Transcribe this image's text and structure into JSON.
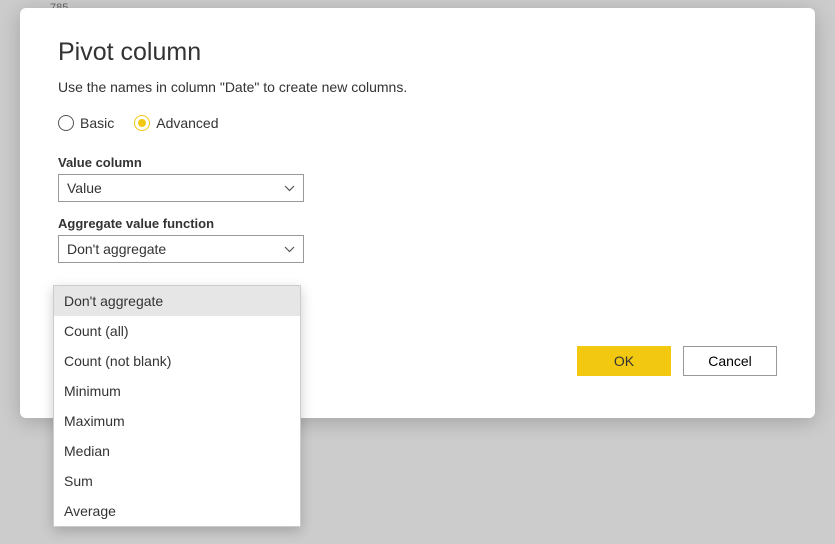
{
  "bg_hint": "785",
  "dialog": {
    "title": "Pivot column",
    "subtitle": "Use the names in column \"Date\" to create new columns.",
    "mode": {
      "basic_label": "Basic",
      "advanced_label": "Advanced"
    },
    "value_column": {
      "label": "Value column",
      "selected": "Value"
    },
    "aggregate": {
      "label": "Aggregate value function",
      "selected": "Don't aggregate",
      "options": [
        "Don't aggregate",
        "Count (all)",
        "Count (not blank)",
        "Minimum",
        "Maximum",
        "Median",
        "Sum",
        "Average"
      ]
    },
    "buttons": {
      "ok": "OK",
      "cancel": "Cancel"
    }
  }
}
